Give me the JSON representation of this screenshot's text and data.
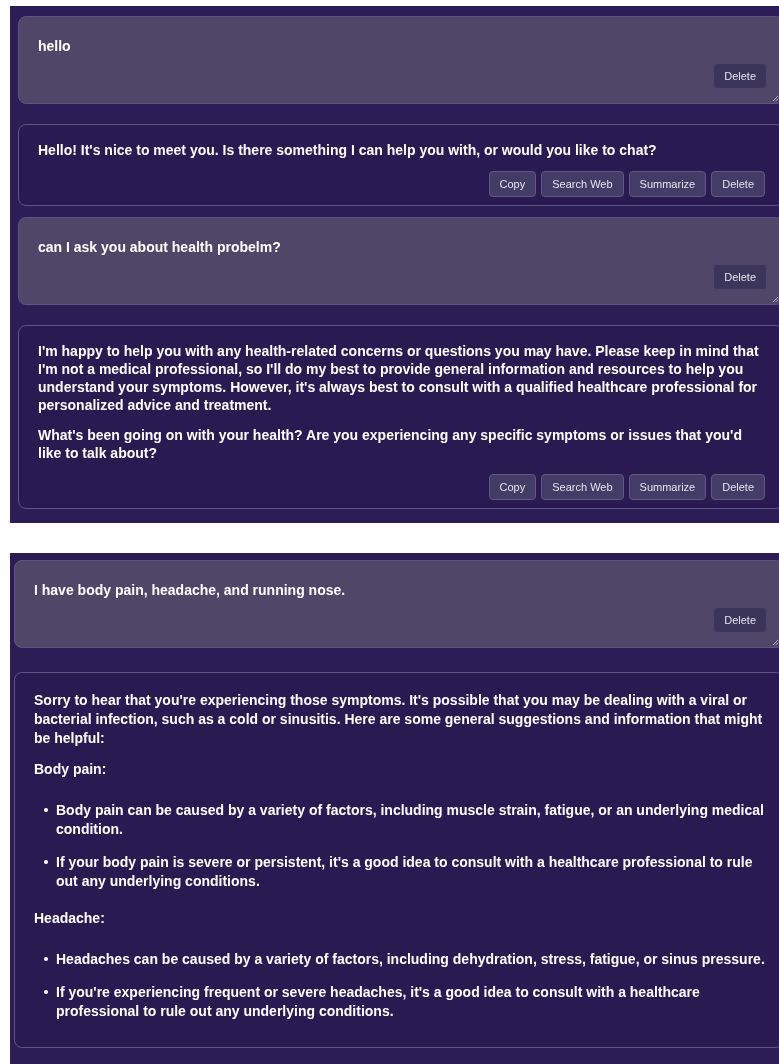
{
  "panels": [
    {
      "messages": [
        {
          "kind": "user",
          "text": "hello",
          "buttons": [
            "Delete"
          ]
        },
        {
          "kind": "assistant",
          "blocks": [
            {
              "kind": "paragraph",
              "text": "Hello! It's nice to meet you. Is there something I can help you with, or would you like to chat?"
            }
          ],
          "buttons": [
            "Copy",
            "Search Web",
            "Summarize",
            "Delete"
          ]
        },
        {
          "kind": "user",
          "text": "can I ask you about health probelm?",
          "buttons": [
            "Delete"
          ]
        },
        {
          "kind": "assistant",
          "blocks": [
            {
              "kind": "paragraph",
              "text": "I'm happy to help you with any health-related concerns or questions you may have. Please keep in mind that I'm not a medical professional, so I'll do my best to provide general information and resources to help you understand your symptoms. However, it's always best to consult with a qualified healthcare professional for personalized advice and treatment."
            },
            {
              "kind": "paragraph",
              "text": "What's been going on with your health? Are you experiencing any specific symptoms or issues that you'd like to talk about?"
            }
          ],
          "buttons": [
            "Copy",
            "Search Web",
            "Summarize",
            "Delete"
          ]
        }
      ]
    },
    {
      "messages": [
        {
          "kind": "user",
          "text": "I have body pain, headache, and running nose.",
          "buttons": [
            "Delete"
          ]
        },
        {
          "kind": "assistant",
          "blocks": [
            {
              "kind": "paragraph",
              "text": "Sorry to hear that you're experiencing those symptoms. It's possible that you may be dealing with a viral or bacterial infection, such as a cold or sinusitis. Here are some general suggestions and information that might be helpful:"
            },
            {
              "kind": "heading",
              "text": "Body pain:"
            },
            {
              "kind": "list",
              "items": [
                "Body pain can be caused by a variety of factors, including muscle strain, fatigue, or an underlying medical condition.",
                "If your body pain is severe or persistent, it's a good idea to consult with a healthcare professional to rule out any underlying conditions."
              ]
            },
            {
              "kind": "heading",
              "text": "Headache:"
            },
            {
              "kind": "list",
              "items": [
                "Headaches can be caused by a variety of factors, including dehydration, stress, fatigue, or sinus pressure.",
                "If you're experiencing frequent or severe headaches, it's a good idea to consult with a healthcare professional to rule out any underlying conditions."
              ]
            }
          ]
        }
      ]
    }
  ]
}
